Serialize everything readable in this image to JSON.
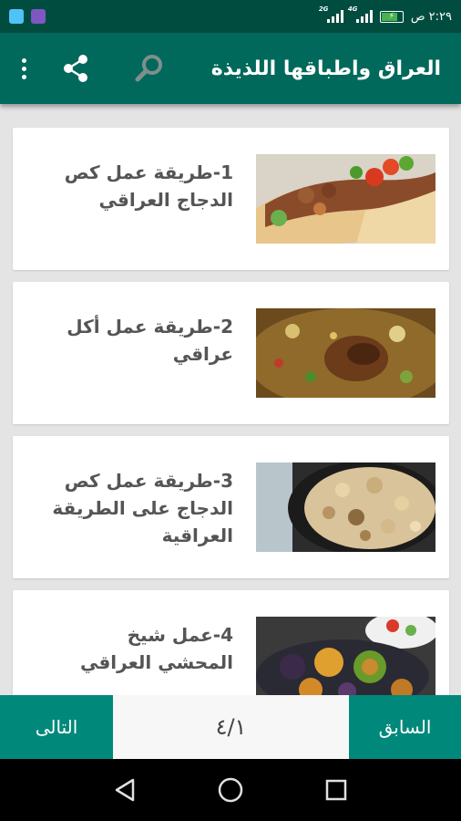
{
  "status_bar": {
    "time": "٢:٢٩ ص",
    "network_labels": [
      "2G",
      "4G"
    ],
    "accent": "#004d40"
  },
  "app_bar": {
    "title": "العراق واطباقها اللذيذة",
    "color": "#00695c",
    "icons": [
      "search-icon",
      "share-icon",
      "more-vert-icon"
    ]
  },
  "recipes": [
    {
      "title": "1-طريقة عمل كص الدجاج العراقي",
      "image": "shawarma-wrap-photo"
    },
    {
      "title": "2-طريقة عمل أكل عراقي",
      "image": "chicken-rice-photo"
    },
    {
      "title": "3-طريقة عمل كص الدجاج على الطريقة العراقية",
      "image": "chicken-pan-photo"
    },
    {
      "title": "4-عمل شيخ المحشي العراقي",
      "image": "stuffed-vegetables-photo"
    }
  ],
  "pagination": {
    "next_label": "التالى",
    "prev_label": "السابق",
    "page": "٤/١",
    "button_color": "#00897b"
  },
  "system_nav": {
    "icons": [
      "back-icon",
      "home-icon",
      "recents-icon"
    ]
  }
}
